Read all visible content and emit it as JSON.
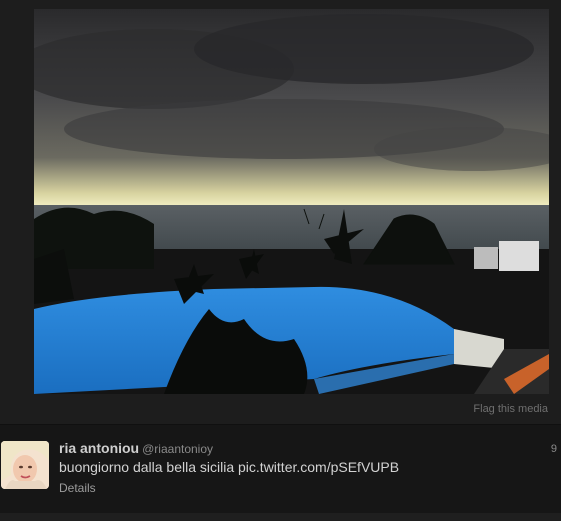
{
  "media": {
    "flag_label": "Flag this media"
  },
  "tweet": {
    "fullname": "ria antoniou",
    "username": "@riaantonioy",
    "timestamp": "9",
    "text_before": "buongiorno dalla bella sicilia ",
    "link_text": "pic.twitter.com/pSEfVUPB",
    "details_label": "Details"
  },
  "colors": {
    "background": "#1d1d1d",
    "tweet_background": "#161616",
    "pool": "#1f7fcf",
    "sky": "#3b3b3b"
  }
}
